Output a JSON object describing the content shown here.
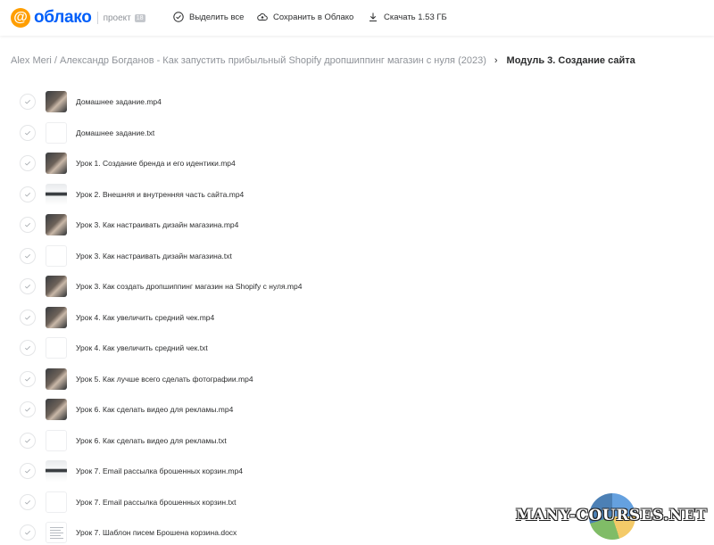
{
  "header": {
    "logo_text": "облако",
    "logo_symbol": "@",
    "project_label": "проект",
    "project_badge": "18",
    "select_all": "Выделить все",
    "save_to_cloud": "Сохранить в Облако",
    "download": "Скачать 1.53 ГБ"
  },
  "breadcrumb": {
    "parent": "Alex Meri / Александр Богданов - Как запустить прибыльный Shopify дропшиппинг магазин с нуля (2023)",
    "current": "Модуль 3. Создание сайта"
  },
  "files": [
    {
      "name": "Домашнее задание.mp4",
      "thumb": "video"
    },
    {
      "name": "Домашнее задание.txt",
      "thumb": "doc"
    },
    {
      "name": "Урок 1. Создание бренда и его идентики.mp4",
      "thumb": "video"
    },
    {
      "name": "Урок 2. Внешняя и внутренняя часть сайта.mp4",
      "thumb": "video-light"
    },
    {
      "name": "Урок 3. Как настраивать дизайн магазина.mp4",
      "thumb": "video"
    },
    {
      "name": "Урок 3. Как настраивать дизайн магазина.txt",
      "thumb": "doc"
    },
    {
      "name": "Урок 3. Как создать дропшиппинг магазин на Shopify с нуля.mp4",
      "thumb": "video"
    },
    {
      "name": "Урок 4. Как увеличить средний чек.mp4",
      "thumb": "video"
    },
    {
      "name": "Урок 4. Как увеличить средний чек.txt",
      "thumb": "doc"
    },
    {
      "name": "Урок 5. Как лучше всего сделать фотографии.mp4",
      "thumb": "video"
    },
    {
      "name": "Урок 6. Как сделать видео для рекламы.mp4",
      "thumb": "video"
    },
    {
      "name": "Урок 6. Как сделать видео для рекламы.txt",
      "thumb": "doc"
    },
    {
      "name": "Урок 7. Email рассылка брошенных корзин.mp4",
      "thumb": "video-light"
    },
    {
      "name": "Урок 7. Email рассылка брошенных корзин.txt",
      "thumb": "doc"
    },
    {
      "name": "Урок 7. Шаблон писем Брошена корзина.docx",
      "thumb": "docx"
    }
  ],
  "watermark": "MANY-COURSES.NET",
  "colors": {
    "brand_blue": "#005ff9",
    "brand_orange": "#ff9e00",
    "muted": "#8f9399",
    "text": "#2c2d2e"
  }
}
